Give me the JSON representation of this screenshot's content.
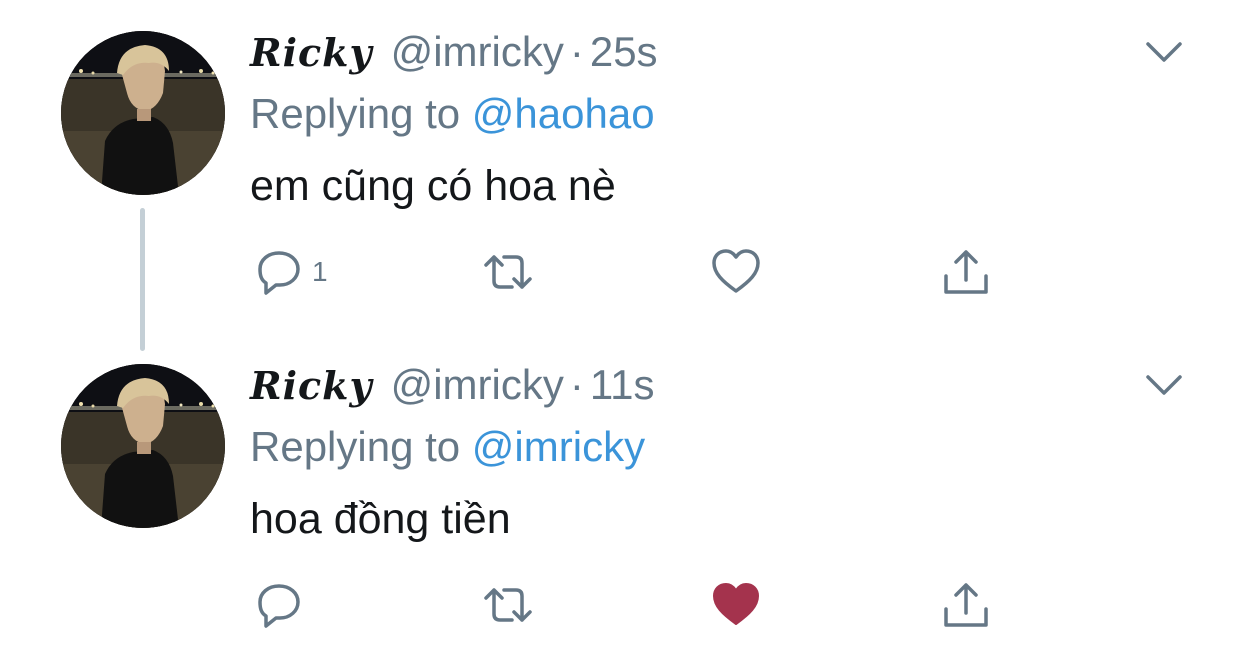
{
  "tweets": [
    {
      "display_name": "Ricky",
      "handle": "@imricky",
      "separator": "·",
      "time": "25s",
      "replying_prefix": "Replying to",
      "replying_to": "@haohao",
      "text": "em cũng có hoa nè",
      "reply_count": "1",
      "liked": false
    },
    {
      "display_name": "Ricky",
      "handle": "@imricky",
      "separator": "·",
      "time": "11s",
      "replying_prefix": "Replying to",
      "replying_to": "@imricky",
      "text": "hoa đồng tiền",
      "reply_count": "",
      "liked": true
    }
  ],
  "colors": {
    "secondary_text": "#657786",
    "link": "#3b94d9",
    "like_active": "#a4334d",
    "thread_line": "#c4cfd6"
  },
  "icons": {
    "menu": "chevron-down-icon",
    "reply": "speech-bubble-icon",
    "retweet": "retweet-icon",
    "like": "heart-icon",
    "share": "share-upload-icon"
  }
}
